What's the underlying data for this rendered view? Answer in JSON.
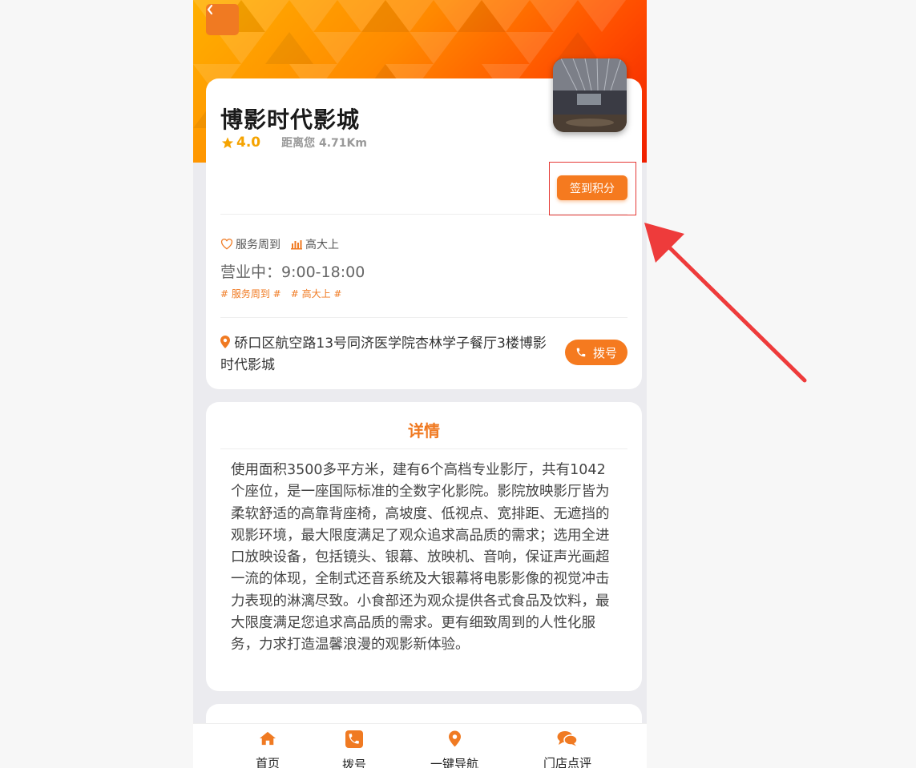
{
  "store": {
    "name": "博影时代影城",
    "rating": "4.0",
    "distance": "距离您 4.71Km",
    "checkin_label": "签到积分",
    "features": [
      "服务周到",
      "高大上"
    ],
    "hours": "营业中：9:00-18:00",
    "tags": [
      "# 服务周到 #",
      "# 高大上 #"
    ],
    "address": "硚口区航空路13号同济医学院杏林学子餐厅3楼博影时代影城",
    "call_label": "拨号"
  },
  "detail": {
    "title": "详情",
    "body": "使用面积3500多平方米，建有6个高档专业影厅，共有1042个座位，是一座国际标准的全数字化影院。影院放映影厅皆为柔软舒适的高靠背座椅，高坡度、低视点、宽排距、无遮挡的观影环境，最大限度满足了观众追求高品质的需求；选用全进口放映设备，包括镜头、银幕、放映机、音响，保证声光画超一流的体现，全制式还音系统及大银幕将电影影像的视觉冲击力表现的淋漓尽致。小食部还为观众提供各式食品及饮料，最大限度满足您追求高品质的需求。更有细致周到的人性化服务，力求打造温馨浪漫的观影新体验。"
  },
  "tabbar": {
    "items": [
      {
        "label": "首页",
        "icon": "home-icon"
      },
      {
        "label": "拨号",
        "icon": "phone-icon"
      },
      {
        "label": "一键导航",
        "icon": "map-pin-icon"
      },
      {
        "label": "门店点评",
        "icon": "comments-icon"
      }
    ]
  },
  "colors": {
    "accent": "#f57a1f",
    "star": "#f5a300",
    "annotation": "#e53935"
  }
}
